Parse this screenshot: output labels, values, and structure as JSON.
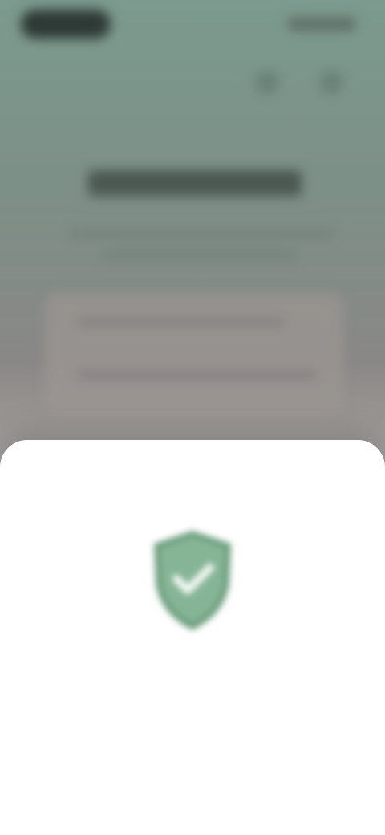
{
  "colors": {
    "backdrop_top": "#7c9a8f",
    "backdrop_bottom": "#a8a3a1",
    "sheet_bg": "#ffffff",
    "shield_green": "#7fae8f",
    "shield_dark": "#5f8d70",
    "title_text": "#1d2320",
    "desc_text": "#6b6f6d"
  },
  "icons": {
    "shield": "shield-check-icon"
  },
  "sheet": {
    "title": "",
    "description": ""
  }
}
